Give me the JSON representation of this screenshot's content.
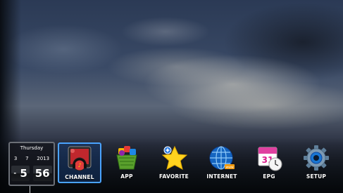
{
  "clock": {
    "day": "Thursday",
    "month": "3",
    "date": "7",
    "year": "2013",
    "hour_prefix": "-",
    "hour": "5",
    "minute": "56"
  },
  "menu": {
    "selected_color": "#4aa3ff",
    "items": [
      {
        "label": "CHANNEL",
        "icon": "channel-tv-icon",
        "selected": true
      },
      {
        "label": "APP",
        "icon": "app-basket-icon",
        "selected": false
      },
      {
        "label": "FAVORITE",
        "icon": "favorite-star-icon",
        "selected": false
      },
      {
        "label": "INTERNET",
        "icon": "internet-globe-icon",
        "selected": false
      },
      {
        "label": "EPG",
        "icon": "epg-calendar-icon",
        "selected": false
      },
      {
        "label": "SETUP",
        "icon": "setup-gear-icon",
        "selected": false
      }
    ]
  },
  "epg_icon_text": "31"
}
